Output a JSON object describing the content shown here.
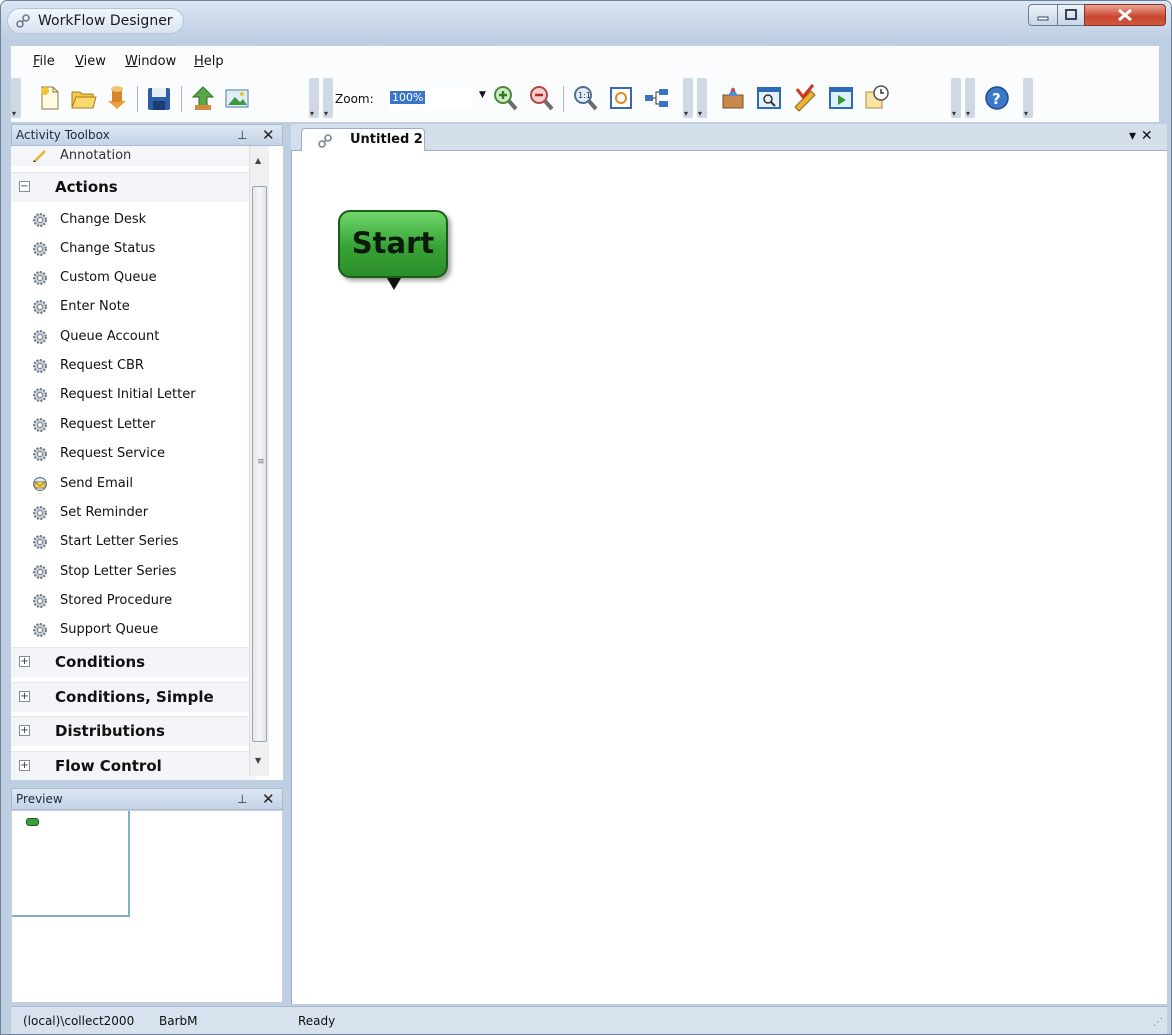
{
  "window": {
    "title": "WorkFlow Designer"
  },
  "menu": [
    {
      "label": "File",
      "accel": "F",
      "rest": "ile"
    },
    {
      "label": "View",
      "accel": "V",
      "rest": "iew"
    },
    {
      "label": "Window",
      "accel": "W",
      "rest": "indow"
    },
    {
      "label": "Help",
      "accel": "H",
      "rest": "elp"
    }
  ],
  "toolbar": {
    "zoom_label": "Zoom:",
    "zoom_value": "100%",
    "icons": [
      "new-document-icon",
      "open-folder-icon",
      "import-icon",
      "save-icon",
      "publish-icon",
      "image-export-icon",
      "zoom-in-icon",
      "zoom-out-icon",
      "zoom-actual-size-icon",
      "zoom-fit-icon",
      "layout-tree-icon",
      "deploy-icon",
      "preview-window-icon",
      "validate-icon",
      "run-icon",
      "schedule-icon",
      "help-icon"
    ]
  },
  "toolbox": {
    "title": "Activity Toolbox",
    "annotation_item": "Annotation",
    "groups": [
      {
        "label": "Actions",
        "expanded": true,
        "items": [
          "Change Desk",
          "Change Status",
          "Custom Queue",
          "Enter Note",
          "Queue Account",
          "Request CBR",
          "Request Initial Letter",
          "Request Letter",
          "Request Service",
          "Send Email",
          "Set Reminder",
          "Start Letter Series",
          "Stop Letter Series",
          "Stored Procedure",
          "Support Queue"
        ]
      },
      {
        "label": "Conditions",
        "expanded": false
      },
      {
        "label": "Conditions, Simple",
        "expanded": false
      },
      {
        "label": "Distributions",
        "expanded": false
      },
      {
        "label": "Flow Control",
        "expanded": false
      }
    ]
  },
  "preview": {
    "title": "Preview"
  },
  "document": {
    "tab_label": "Untitled 2",
    "start_node_label": "Start"
  },
  "statusbar": {
    "server": "(local)\\collect2000",
    "user": "BarbM",
    "status": "Ready"
  },
  "colors": {
    "start_node": "#36a235",
    "panel_header": "#c4d3e6",
    "zoom_highlight": "#3a75c8"
  }
}
